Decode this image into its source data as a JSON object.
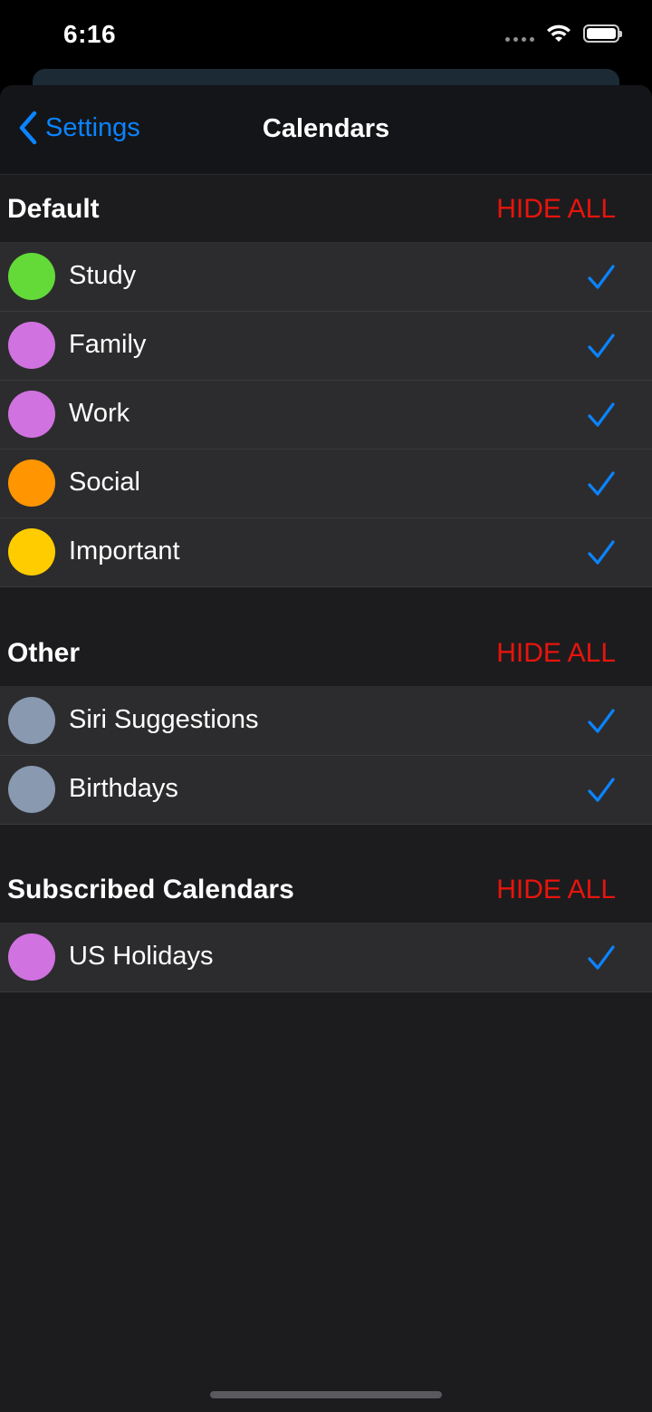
{
  "status_bar": {
    "time": "6:16"
  },
  "nav": {
    "back_label": "Settings",
    "title": "Calendars"
  },
  "colors": {
    "accent": "#0a84ff",
    "destructive": "#e8140c",
    "green": "#63da38",
    "purple": "#d072e0",
    "orange": "#ff9500",
    "yellow": "#ffcc00",
    "gray": "#8899b0"
  },
  "sections": [
    {
      "title": "Default",
      "action": "HIDE ALL",
      "items": [
        {
          "label": "Study",
          "color": "#63da38",
          "checked": true
        },
        {
          "label": "Family",
          "color": "#d072e0",
          "checked": true
        },
        {
          "label": "Work",
          "color": "#d072e0",
          "checked": true
        },
        {
          "label": "Social",
          "color": "#ff9500",
          "checked": true
        },
        {
          "label": "Important",
          "color": "#ffcc00",
          "checked": true
        }
      ]
    },
    {
      "title": "Other",
      "action": "HIDE ALL",
      "items": [
        {
          "label": "Siri Suggestions",
          "color": "#8899b0",
          "checked": true
        },
        {
          "label": "Birthdays",
          "color": "#8899b0",
          "checked": true
        }
      ]
    },
    {
      "title": "Subscribed Calendars",
      "action": "HIDE ALL",
      "items": [
        {
          "label": "US Holidays",
          "color": "#d072e0",
          "checked": true
        }
      ]
    }
  ]
}
